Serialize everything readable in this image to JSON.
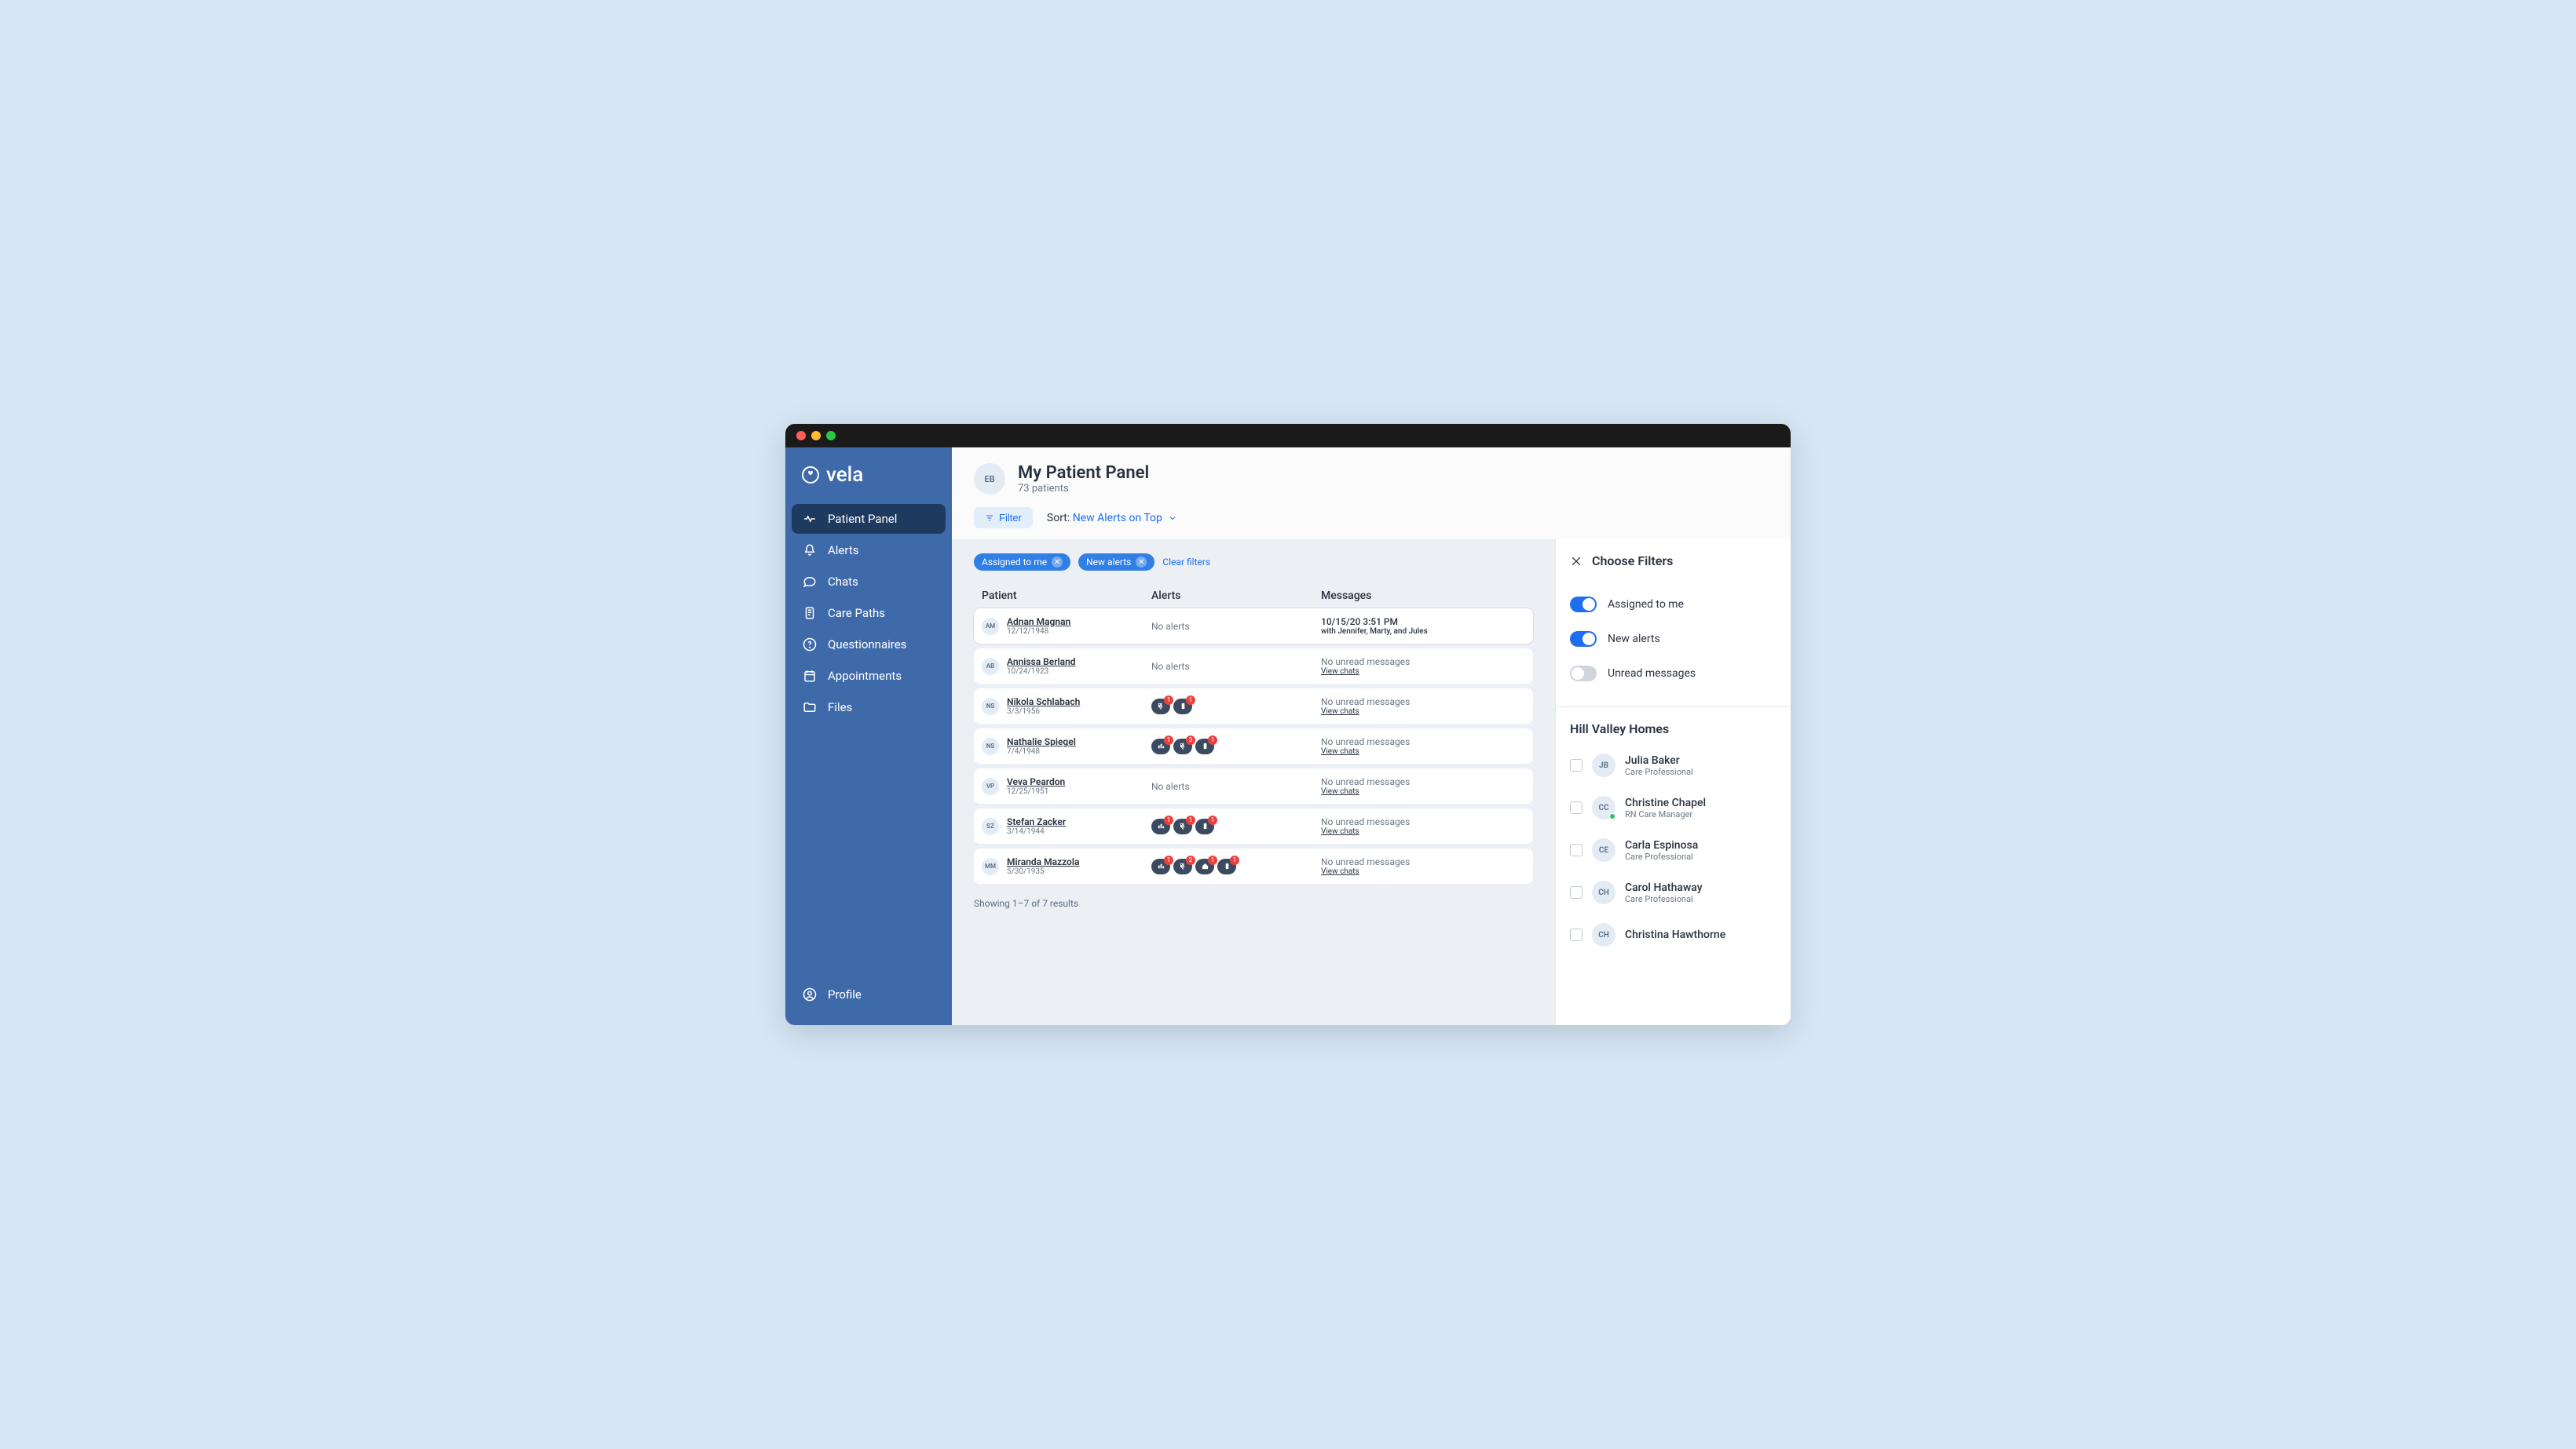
{
  "brand": "vela",
  "header": {
    "avatar": "EB",
    "title": "My Patient Panel",
    "subtitle": "73 patients"
  },
  "toolbar": {
    "filter": "Filter",
    "sort_label": "Sort:",
    "sort_value": "New Alerts on Top"
  },
  "nav": [
    {
      "label": "Patient Panel"
    },
    {
      "label": "Alerts"
    },
    {
      "label": "Chats"
    },
    {
      "label": "Care Paths"
    },
    {
      "label": "Questionnaires"
    },
    {
      "label": "Appointments"
    },
    {
      "label": "Files"
    }
  ],
  "profile_label": "Profile",
  "chips": [
    {
      "label": "Assigned to me"
    },
    {
      "label": "New alerts"
    }
  ],
  "clear_filters": "Clear filters",
  "columns": {
    "patient": "Patient",
    "alerts": "Alerts",
    "messages": "Messages"
  },
  "no_alerts": "No alerts",
  "no_unread": "No unread messages",
  "view_chats": "View chats",
  "patients": [
    {
      "initials": "AM",
      "name": "Adnan Magnan",
      "dob": "12/12/1948",
      "alerts": [],
      "msg_l1": "10/15/20 3:51 PM",
      "msg_l2": "with Jennifer, Marty, and Jules",
      "selected": true,
      "dark": true,
      "l2link": false
    },
    {
      "initials": "AB",
      "name": "Annissa Berland",
      "dob": "10/24/1923",
      "alerts": [],
      "msg_l1": "",
      "msg_l2": ""
    },
    {
      "initials": "NS",
      "name": "Nikola Schlabach",
      "dob": "3/3/1956",
      "alerts": [
        {
          "t": "rx",
          "n": 1
        },
        {
          "t": "med",
          "n": 1
        }
      ],
      "msg_l1": "",
      "msg_l2": ""
    },
    {
      "initials": "NS",
      "name": "Nathalie Spiegel",
      "dob": "7/4/1948",
      "alerts": [
        {
          "t": "vit",
          "n": 1
        },
        {
          "t": "rx",
          "n": 3
        },
        {
          "t": "med",
          "n": 1
        }
      ],
      "msg_l1": "",
      "msg_l2": ""
    },
    {
      "initials": "VP",
      "name": "Veva Peardon",
      "dob": "12/25/1951",
      "alerts": [],
      "msg_l1": "",
      "msg_l2": ""
    },
    {
      "initials": "SZ",
      "name": "Stefan Zacker",
      "dob": "3/14/1944",
      "alerts": [
        {
          "t": "vit",
          "n": 1
        },
        {
          "t": "rx",
          "n": 1
        },
        {
          "t": "med",
          "n": 1
        }
      ],
      "msg_l1": "",
      "msg_l2": ""
    },
    {
      "initials": "MM",
      "name": "Miranda Mazzola",
      "dob": "5/30/1935",
      "alerts": [
        {
          "t": "vit",
          "n": 1
        },
        {
          "t": "rx",
          "n": 2
        },
        {
          "t": "home",
          "n": 1
        },
        {
          "t": "med",
          "n": 1
        }
      ],
      "msg_l1": "",
      "msg_l2": ""
    }
  ],
  "results_text": "Showing 1–7 of 7 results",
  "filter_panel": {
    "title": "Choose Filters",
    "toggles": [
      {
        "label": "Assigned to me",
        "on": true
      },
      {
        "label": "New alerts",
        "on": true
      },
      {
        "label": "Unread messages",
        "on": false
      }
    ],
    "group": "Hill Valley Homes",
    "people": [
      {
        "initials": "JB",
        "name": "Julia Baker",
        "role": "Care Professional",
        "online": false
      },
      {
        "initials": "CC",
        "name": "Christine Chapel",
        "role": "RN Care Manager",
        "online": true
      },
      {
        "initials": "CE",
        "name": "Carla Espinosa",
        "role": "Care Professional",
        "online": false
      },
      {
        "initials": "CH",
        "name": "Carol Hathaway",
        "role": "Care Professional",
        "online": false
      },
      {
        "initials": "CH",
        "name": "Christina Hawthorne",
        "role": "",
        "online": false
      }
    ]
  }
}
